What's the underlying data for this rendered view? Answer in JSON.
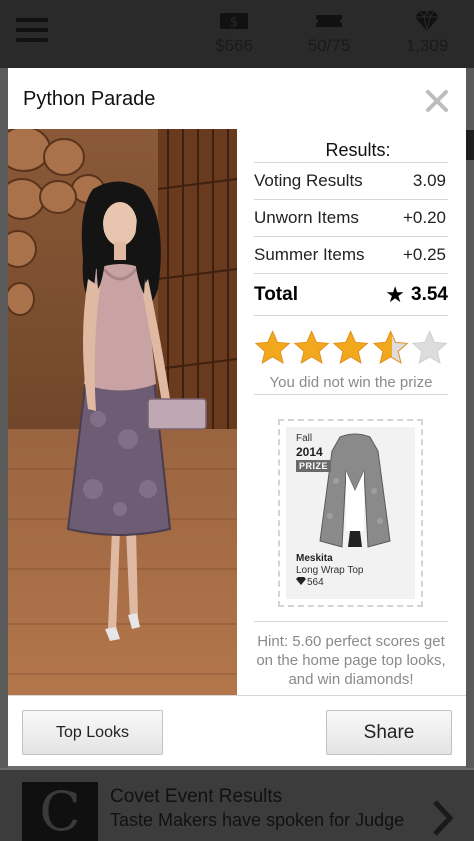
{
  "header": {
    "cash": "$666",
    "energy": "50/75",
    "diamonds": "1,309"
  },
  "modal": {
    "title": "Python Parade",
    "results_heading": "Results:",
    "rows": [
      {
        "label": "Voting Results",
        "value": "3.09"
      },
      {
        "label": "Unworn Items",
        "value": "+0.20"
      },
      {
        "label": "Summer Items",
        "value": "+0.25"
      }
    ],
    "total_label": "Total",
    "total_value": "3.54",
    "star_rating": 3.54,
    "prize_message": "You did not win the prize",
    "prize_card": {
      "season": "Fall",
      "year": "2014",
      "badge": "PRIZE",
      "brand": "Meskita",
      "item": "Long Wrap Top",
      "price": "564"
    },
    "hint": "Hint: 5.60 perfect scores get on the home page top looks, and win diamonds!",
    "buttons": {
      "top_looks": "Top Looks",
      "share": "Share"
    }
  },
  "feed": {
    "thumb_letter": "C",
    "title": "Covet Event Results",
    "subtitle": "Taste Makers have spoken for Judge"
  },
  "colors": {
    "star_fill": "#f2a81d",
    "star_empty": "#dddddd",
    "muted_text": "#8a8a8a"
  }
}
